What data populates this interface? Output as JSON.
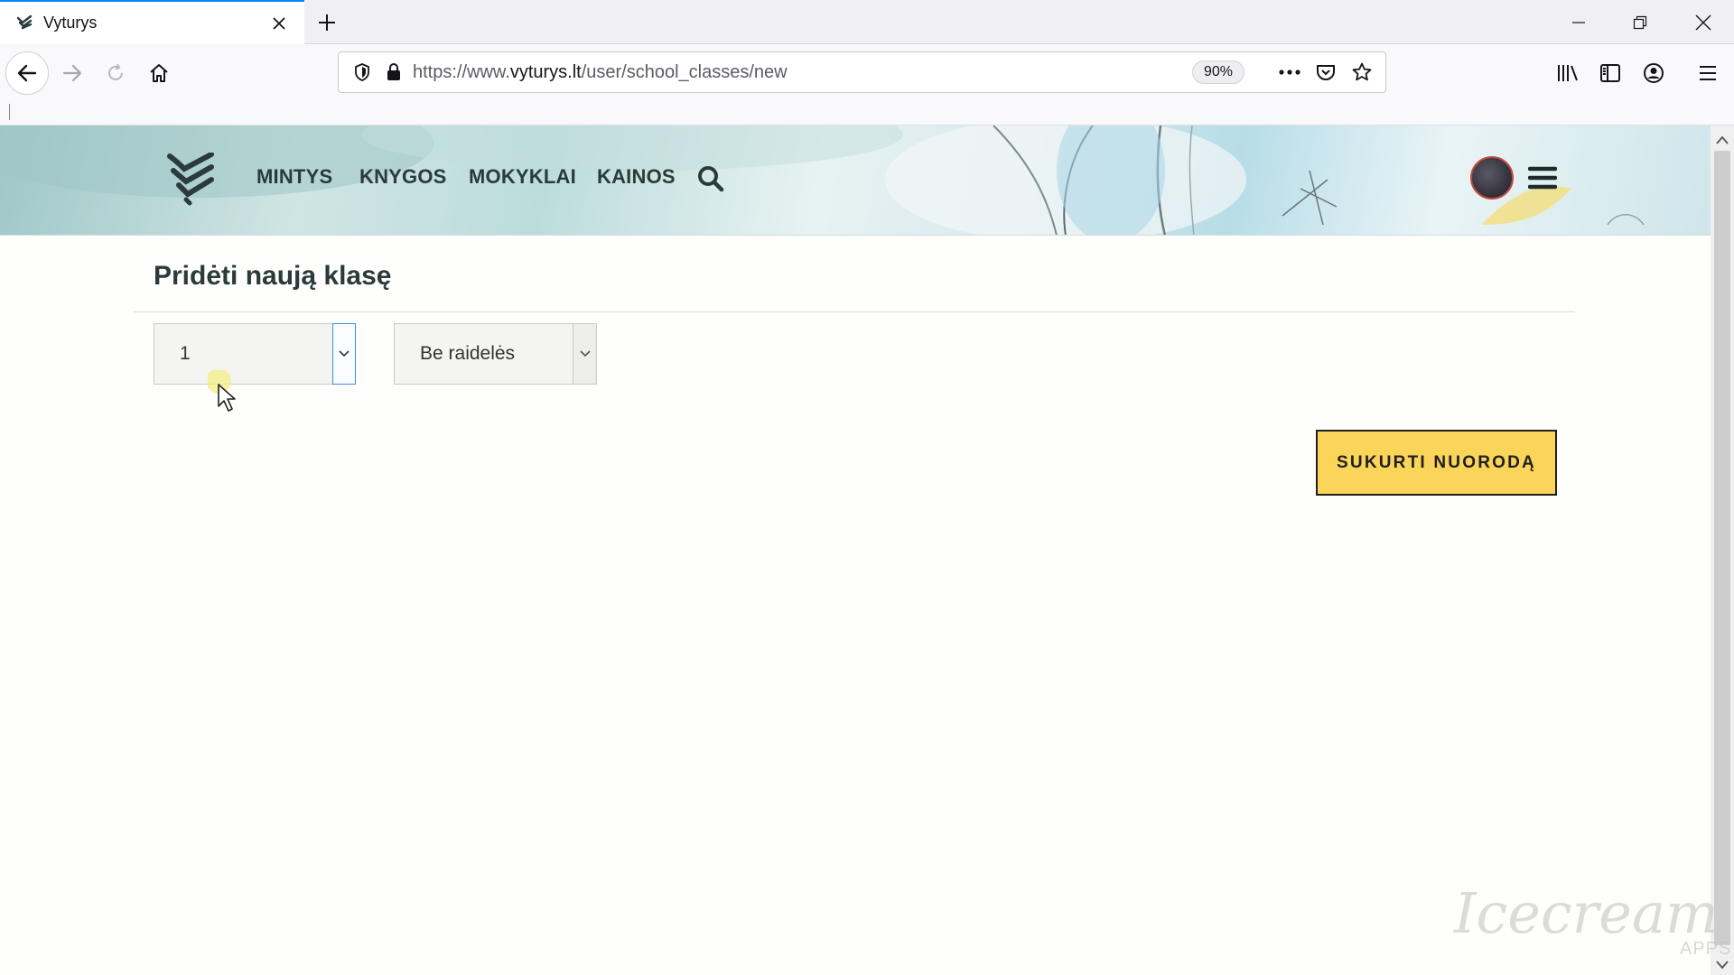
{
  "browser": {
    "tab_title": "Vyturys",
    "url_prefix": "https://www.",
    "url_domain": "vyturys.lt",
    "url_path": "/user/school_classes/new",
    "zoom": "90%"
  },
  "site": {
    "nav": [
      "MINTYS",
      "KNYGOS",
      "MOKYKLAI",
      "KAINOS"
    ]
  },
  "form": {
    "title": "Pridėti naują klasę",
    "grade_value": "1",
    "letter_value": "Be raidelės",
    "submit_label": "SUKURTI NUORODĄ"
  },
  "watermark": {
    "text": "Icecream",
    "sub": "APPS"
  },
  "colors": {
    "accent_tab": "#0a84ff",
    "button_bg": "#fbd45a",
    "text_dark": "#2c3a3c"
  }
}
